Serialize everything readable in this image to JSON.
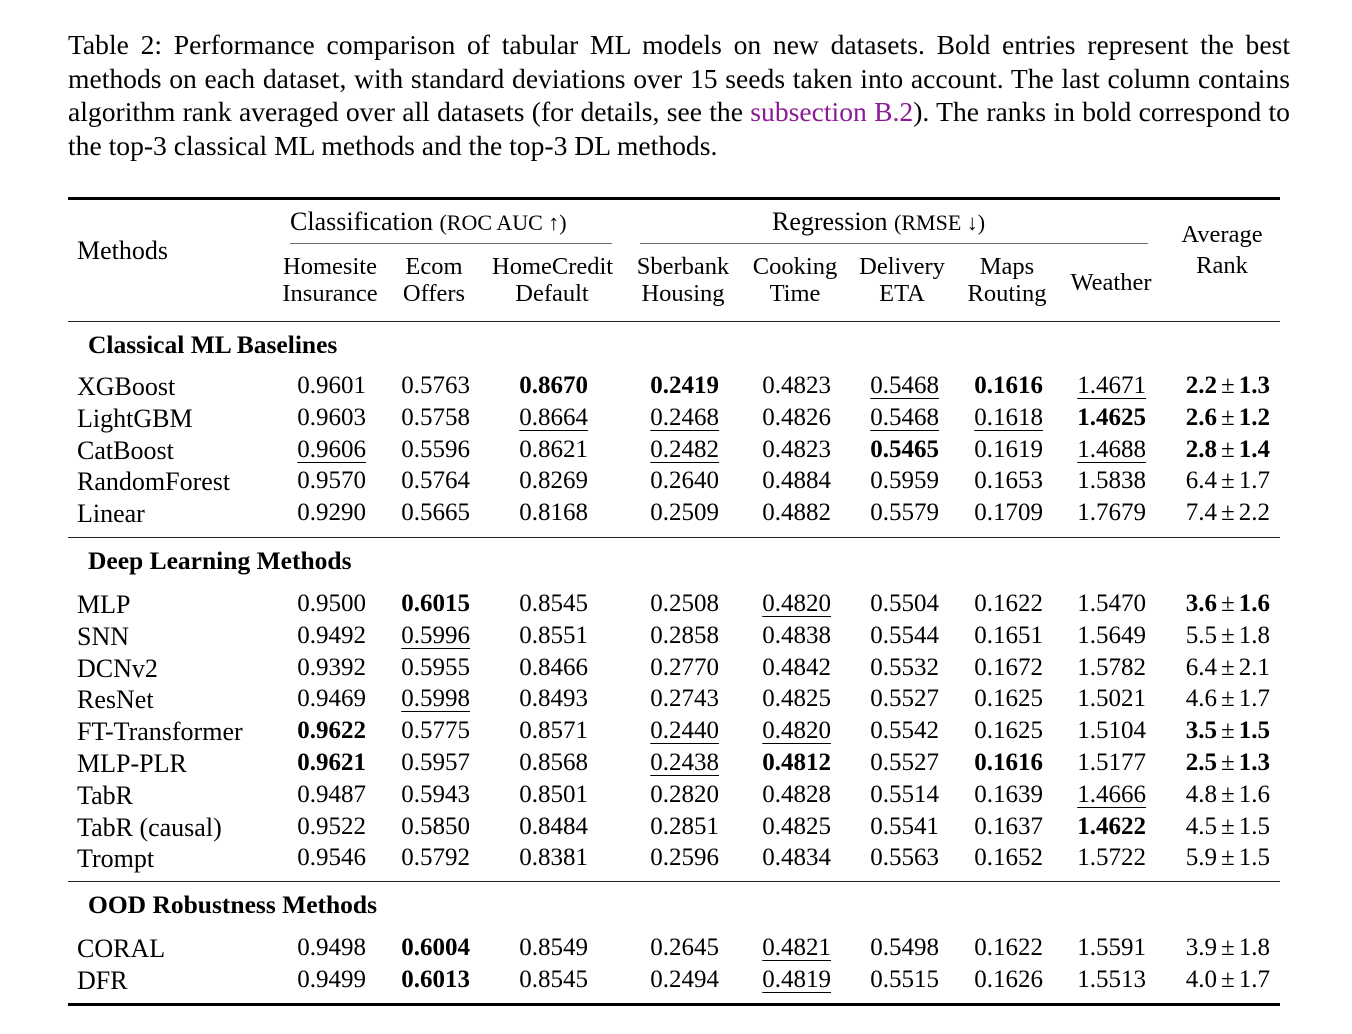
{
  "caption": {
    "prefix": "Table 2: Performance comparison of tabular ML models on new datasets. Bold entries represent the best methods on each dataset, with standard deviations over 15 seeds taken into account. The last column contains algorithm rank averaged over all datasets (for details, see the ",
    "link": "subsection B.2",
    "suffix": "). The ranks in bold correspond to the top-3 classical ML methods and the top-3 DL methods."
  },
  "header": {
    "methods": "Methods",
    "classification_group": "Classification",
    "classification_metric": "(ROC AUC ↑)",
    "regression_group": "Regression",
    "regression_metric": "(RMSE ↓)",
    "rank_line1": "Average",
    "rank_line2": "Rank",
    "columns": [
      {
        "line1": "Homesite",
        "line2": "Insurance"
      },
      {
        "line1": "Ecom",
        "line2": "Offers"
      },
      {
        "line1": "HomeCredit",
        "line2": "Default"
      },
      {
        "line1": "Sberbank",
        "line2": "Housing"
      },
      {
        "line1": "Cooking",
        "line2": "Time"
      },
      {
        "line1": "Delivery",
        "line2": "ETA"
      },
      {
        "line1": "Maps",
        "line2": "Routing"
      },
      {
        "line1": "Weather",
        "line2": ""
      }
    ]
  },
  "sections": [
    {
      "title": "Classical ML Baselines",
      "rows": [
        {
          "method": "XGBoost",
          "values": [
            "0.9601",
            "0.5763",
            "0.8670",
            "0.2419",
            "0.4823",
            "0.5468",
            "0.1616",
            "1.4671"
          ],
          "bold": [
            2,
            3,
            6
          ],
          "underline": [
            5,
            7
          ],
          "rank": "2.2",
          "rank_std": "1.3",
          "rank_bold": true
        },
        {
          "method": "LightGBM",
          "values": [
            "0.9603",
            "0.5758",
            "0.8664",
            "0.2468",
            "0.4826",
            "0.5468",
            "0.1618",
            "1.4625"
          ],
          "bold": [
            7
          ],
          "underline": [
            2,
            3,
            5,
            6
          ],
          "rank": "2.6",
          "rank_std": "1.2",
          "rank_bold": true
        },
        {
          "method": "CatBoost",
          "values": [
            "0.9606",
            "0.5596",
            "0.8621",
            "0.2482",
            "0.4823",
            "0.5465",
            "0.1619",
            "1.4688"
          ],
          "bold": [
            5
          ],
          "underline": [
            0,
            3,
            7
          ],
          "rank": "2.8",
          "rank_std": "1.4",
          "rank_bold": true
        },
        {
          "method": "RandomForest",
          "values": [
            "0.9570",
            "0.5764",
            "0.8269",
            "0.2640",
            "0.4884",
            "0.5959",
            "0.1653",
            "1.5838"
          ],
          "bold": [],
          "underline": [],
          "rank": "6.4",
          "rank_std": "1.7",
          "rank_bold": false
        },
        {
          "method": "Linear",
          "values": [
            "0.9290",
            "0.5665",
            "0.8168",
            "0.2509",
            "0.4882",
            "0.5579",
            "0.1709",
            "1.7679"
          ],
          "bold": [],
          "underline": [],
          "rank": "7.4",
          "rank_std": "2.2",
          "rank_bold": false
        }
      ]
    },
    {
      "title": "Deep Learning Methods",
      "rows": [
        {
          "method": "MLP",
          "values": [
            "0.9500",
            "0.6015",
            "0.8545",
            "0.2508",
            "0.4820",
            "0.5504",
            "0.1622",
            "1.5470"
          ],
          "bold": [
            1
          ],
          "underline": [
            4
          ],
          "rank": "3.6",
          "rank_std": "1.6",
          "rank_bold": true
        },
        {
          "method": "SNN",
          "values": [
            "0.9492",
            "0.5996",
            "0.8551",
            "0.2858",
            "0.4838",
            "0.5544",
            "0.1651",
            "1.5649"
          ],
          "bold": [],
          "underline": [
            1
          ],
          "rank": "5.5",
          "rank_std": "1.8",
          "rank_bold": false
        },
        {
          "method": "DCNv2",
          "values": [
            "0.9392",
            "0.5955",
            "0.8466",
            "0.2770",
            "0.4842",
            "0.5532",
            "0.1672",
            "1.5782"
          ],
          "bold": [],
          "underline": [],
          "rank": "6.4",
          "rank_std": "2.1",
          "rank_bold": false
        },
        {
          "method": "ResNet",
          "values": [
            "0.9469",
            "0.5998",
            "0.8493",
            "0.2743",
            "0.4825",
            "0.5527",
            "0.1625",
            "1.5021"
          ],
          "bold": [],
          "underline": [
            1
          ],
          "rank": "4.6",
          "rank_std": "1.7",
          "rank_bold": false
        },
        {
          "method": "FT-Transformer",
          "values": [
            "0.9622",
            "0.5775",
            "0.8571",
            "0.2440",
            "0.4820",
            "0.5542",
            "0.1625",
            "1.5104"
          ],
          "bold": [
            0
          ],
          "underline": [
            3,
            4
          ],
          "rank": "3.5",
          "rank_std": "1.5",
          "rank_bold": true
        },
        {
          "method": "MLP-PLR",
          "values": [
            "0.9621",
            "0.5957",
            "0.8568",
            "0.2438",
            "0.4812",
            "0.5527",
            "0.1616",
            "1.5177"
          ],
          "bold": [
            0,
            4,
            6
          ],
          "underline": [
            3
          ],
          "rank": "2.5",
          "rank_std": "1.3",
          "rank_bold": true
        },
        {
          "method": "TabR",
          "values": [
            "0.9487",
            "0.5943",
            "0.8501",
            "0.2820",
            "0.4828",
            "0.5514",
            "0.1639",
            "1.4666"
          ],
          "bold": [],
          "underline": [
            7
          ],
          "rank": "4.8",
          "rank_std": "1.6",
          "rank_bold": false
        },
        {
          "method": "TabR (causal)",
          "values": [
            "0.9522",
            "0.5850",
            "0.8484",
            "0.2851",
            "0.4825",
            "0.5541",
            "0.1637",
            "1.4622"
          ],
          "bold": [
            7
          ],
          "underline": [],
          "rank": "4.5",
          "rank_std": "1.5",
          "rank_bold": false
        },
        {
          "method": "Trompt",
          "values": [
            "0.9546",
            "0.5792",
            "0.8381",
            "0.2596",
            "0.4834",
            "0.5563",
            "0.1652",
            "1.5722"
          ],
          "bold": [],
          "underline": [],
          "rank": "5.9",
          "rank_std": "1.5",
          "rank_bold": false
        }
      ]
    },
    {
      "title": "OOD Robustness Methods",
      "rows": [
        {
          "method": "CORAL",
          "values": [
            "0.9498",
            "0.6004",
            "0.8549",
            "0.2645",
            "0.4821",
            "0.5498",
            "0.1622",
            "1.5591"
          ],
          "bold": [
            1
          ],
          "underline": [
            4
          ],
          "rank": "3.9",
          "rank_std": "1.8",
          "rank_bold": false
        },
        {
          "method": "DFR",
          "values": [
            "0.9499",
            "0.6013",
            "0.8545",
            "0.2494",
            "0.4819",
            "0.5515",
            "0.1626",
            "1.5513"
          ],
          "bold": [
            1
          ],
          "underline": [
            4
          ],
          "rank": "4.0",
          "rank_std": "1.7",
          "rank_bold": false
        }
      ]
    }
  ],
  "pm_symbol": "±"
}
